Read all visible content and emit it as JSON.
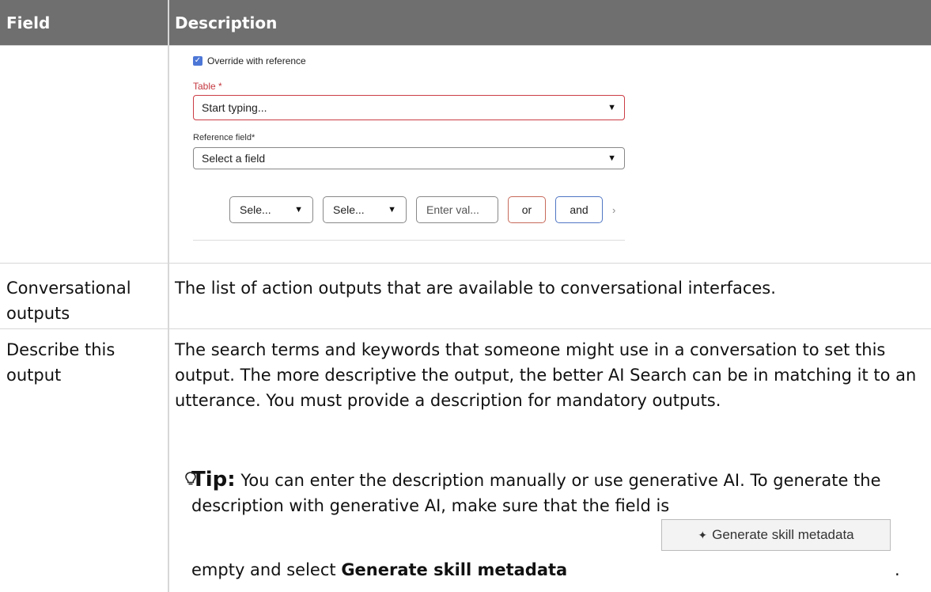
{
  "table": {
    "headers": {
      "field": "Field",
      "description": "Description"
    },
    "embedded_form": {
      "checkbox_label": "Override with reference",
      "table_label": "Table",
      "required_marker": "*",
      "table_placeholder": "Start typing...",
      "ref_label": "Reference field",
      "ref_placeholder": "Select a field",
      "cond": {
        "select1": "Sele...",
        "select2": "Sele...",
        "input_placeholder": "Enter val...",
        "or": "or",
        "and": "and"
      }
    },
    "rows": [
      {
        "field": "Conversational outputs",
        "description": "The list of action outputs that are available to conversational interfaces."
      },
      {
        "field": "Describe this output",
        "description": "The search terms and keywords that someone might use in a conversation to set this output. The more descriptive the output, the better AI Search can be in matching it to an utterance. You must provide a description for mandatory outputs."
      }
    ],
    "tip": {
      "label": "Tip:",
      "text1": "You can enter the description manually or use generative AI. To generate the description with generative AI, make sure that the field is",
      "text2_pre": "empty and select ",
      "text2_bold": "Generate skill metadata",
      "button_label": "Generate skill metadata",
      "period": "."
    }
  }
}
